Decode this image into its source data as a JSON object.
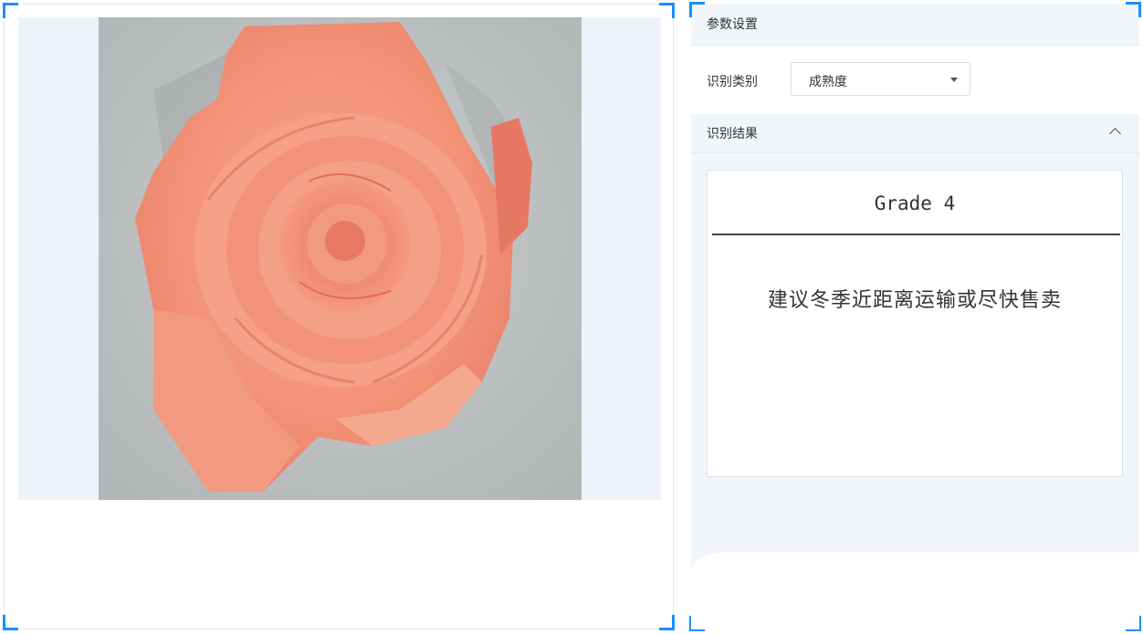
{
  "viewer": {
    "image_subject": "coral-pink rose"
  },
  "settings": {
    "section_title": "参数设置",
    "recognition_type_label": "识别类别",
    "recognition_type_value": "成熟度",
    "result_header": "识别结果"
  },
  "result": {
    "grade": "Grade 4",
    "advice": "建议冬季近距离运输或尽快售卖"
  },
  "colors": {
    "accent": "#1890ff",
    "panel_bg": "#f2f5f9",
    "stage_bg": "#eef2f8",
    "rose": "#f08a70"
  }
}
